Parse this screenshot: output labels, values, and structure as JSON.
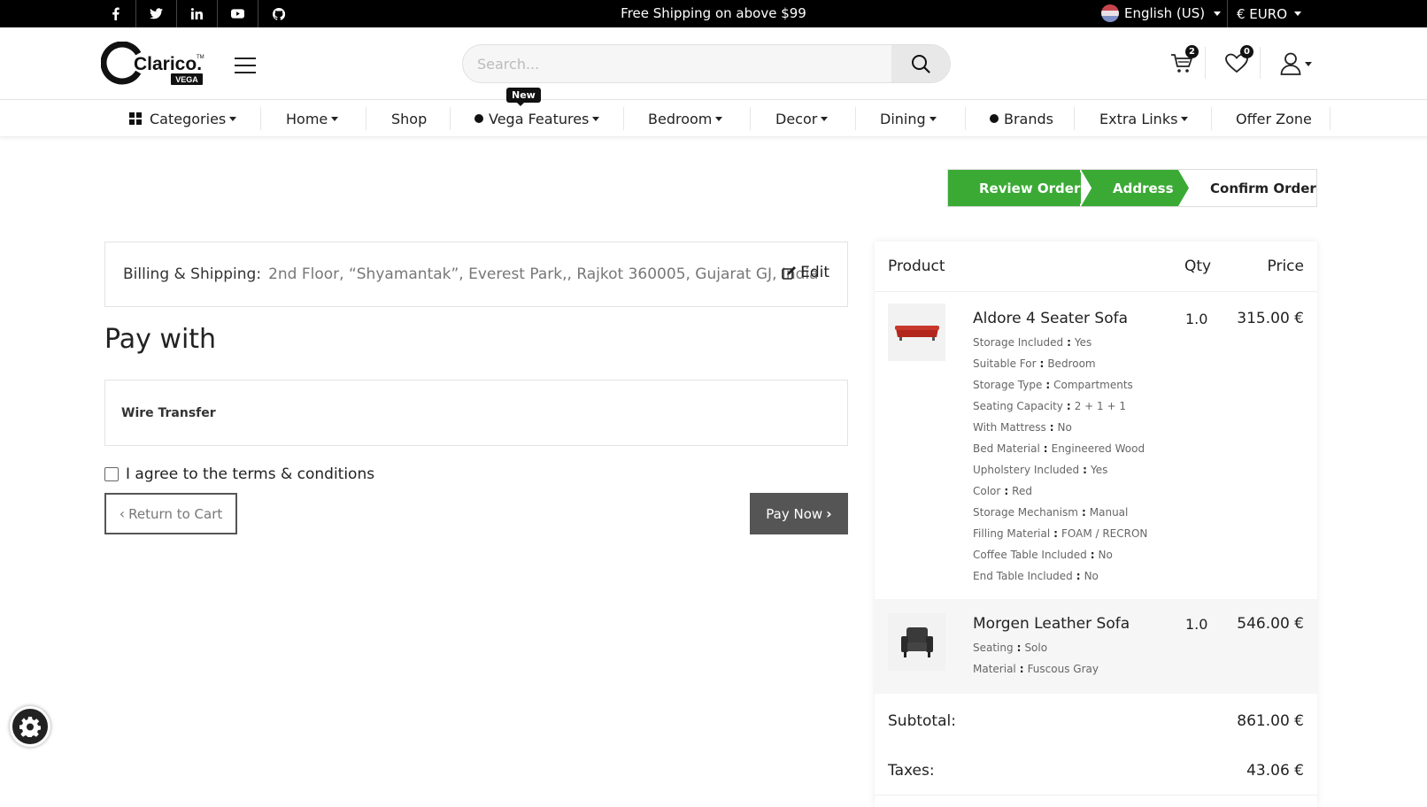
{
  "topbar": {
    "social": [
      "facebook-icon",
      "twitter-icon",
      "linkedin-icon",
      "youtube-icon",
      "github-icon"
    ],
    "promo": "Free Shipping on above $99",
    "language": "English (US)",
    "currency": "€ EURO"
  },
  "header": {
    "logo_text": "Clarico.",
    "logo_badge": "VEGA",
    "logo_tm": "TM",
    "search_placeholder": "Search...",
    "cart_count": "2",
    "wishlist_count": "0"
  },
  "nav": {
    "new_badge": "New",
    "items": [
      {
        "label": "Categories"
      },
      {
        "label": "Home"
      },
      {
        "label": "Shop"
      },
      {
        "label": "Vega Features"
      },
      {
        "label": "Bedroom"
      },
      {
        "label": "Decor"
      },
      {
        "label": "Dining"
      },
      {
        "label": "Brands"
      },
      {
        "label": "Extra Links"
      },
      {
        "label": "Offer Zone"
      }
    ]
  },
  "wizard": {
    "steps": [
      "Review Order",
      "Address",
      "Confirm Order"
    ],
    "colors": {
      "done": "#3aaa35"
    }
  },
  "billing": {
    "label": "Billing & Shipping:",
    "address": "2nd Floor, “Shyamantak”, Everest Park,, Rajkot 360005, Gujarat GJ, India",
    "edit": "Edit"
  },
  "payment": {
    "title": "Pay with",
    "method": "Wire Transfer",
    "terms": "I agree to the terms & conditions",
    "return_btn": "Return to Cart",
    "pay_btn": "Pay Now"
  },
  "summary": {
    "headers": {
      "product": "Product",
      "qty": "Qty",
      "price": "Price"
    },
    "products": [
      {
        "name": "Aldore 4 Seater Sofa",
        "qty": "1.0",
        "price": "315.00 €",
        "attributes": [
          {
            "k": "Storage Included",
            "v": "Yes"
          },
          {
            "k": "Suitable For",
            "v": "Bedroom"
          },
          {
            "k": "Storage Type",
            "v": "Compartments"
          },
          {
            "k": "Seating Capacity",
            "v": "2 + 1 + 1"
          },
          {
            "k": "With Mattress",
            "v": "No"
          },
          {
            "k": "Bed Material",
            "v": "Engineered Wood"
          },
          {
            "k": "Upholstery Included",
            "v": "Yes"
          },
          {
            "k": "Color",
            "v": "Red"
          },
          {
            "k": "Storage Mechanism",
            "v": "Manual"
          },
          {
            "k": "Filling Material",
            "v": "FOAM / RECRON"
          },
          {
            "k": "Coffee Table Included",
            "v": "No"
          },
          {
            "k": "End Table Included",
            "v": "No"
          }
        ]
      },
      {
        "name": "Morgen Leather Sofa",
        "qty": "1.0",
        "price": "546.00 €",
        "attributes": [
          {
            "k": "Seating",
            "v": "Solo"
          },
          {
            "k": "Material",
            "v": "Fuscous Gray"
          }
        ]
      }
    ],
    "subtotal_label": "Subtotal:",
    "subtotal": "861.00 €",
    "taxes_label": "Taxes:",
    "taxes": "43.06 €"
  }
}
